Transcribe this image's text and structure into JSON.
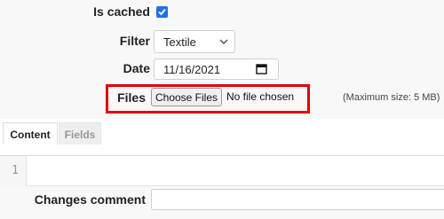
{
  "form": {
    "is_cached": {
      "label": "Is cached",
      "checked": true
    },
    "filter": {
      "label": "Filter",
      "value": "Textile"
    },
    "date": {
      "label": "Date",
      "value": "11/16/2021"
    },
    "files": {
      "label": "Files",
      "button": "Choose Files",
      "status": "No file chosen",
      "max_size": "(Maximum size: 5 MB)"
    }
  },
  "tabs": [
    {
      "label": "Content",
      "active": true
    },
    {
      "label": "Fields",
      "active": false
    }
  ],
  "editor": {
    "line_number": "1"
  },
  "changes_comment": {
    "label": "Changes comment",
    "value": ""
  },
  "colors": {
    "highlight": "#e00000",
    "checkbox": "#1a73e8"
  },
  "icons": {
    "filter_dropdown": "chevron-down-icon",
    "date_picker": "calendar-icon",
    "checkbox": "check-icon"
  }
}
